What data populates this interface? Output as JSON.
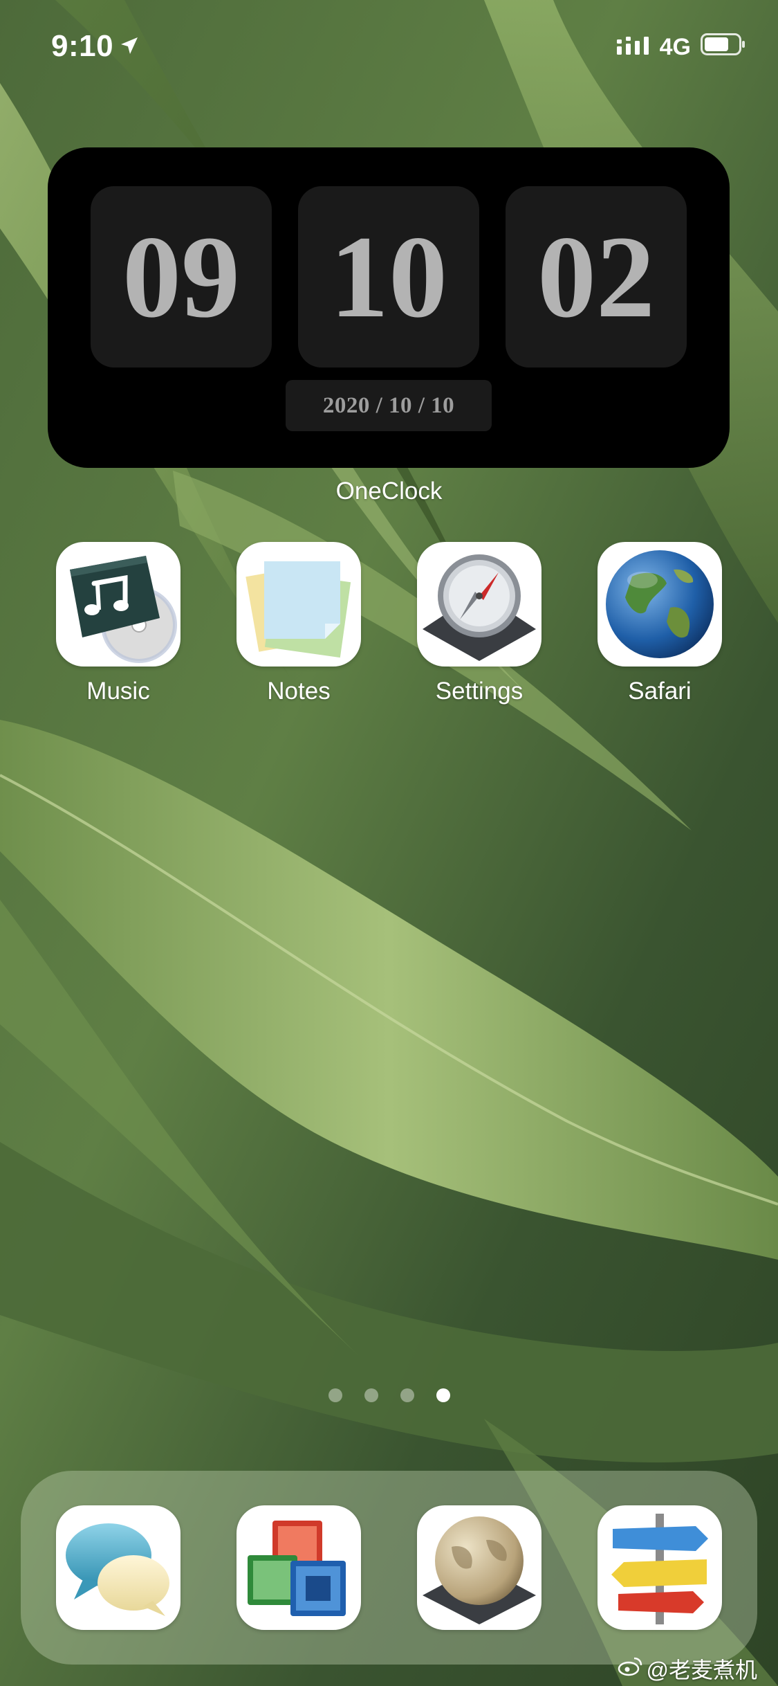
{
  "status_bar": {
    "time": "9:10",
    "network": "4G"
  },
  "widget": {
    "hours": "09",
    "minutes": "10",
    "seconds": "02",
    "date": "2020 / 10 / 10",
    "name": "OneClock"
  },
  "apps": [
    {
      "label": "Music",
      "icon": "music-icon"
    },
    {
      "label": "Notes",
      "icon": "notes-icon"
    },
    {
      "label": "Settings",
      "icon": "compass-icon"
    },
    {
      "label": "Safari",
      "icon": "globe-icon"
    }
  ],
  "page_indicator": {
    "total_pages": 4,
    "current_page": 4
  },
  "dock": [
    {
      "icon": "chat-bubbles-icon"
    },
    {
      "icon": "overlapping-windows-icon"
    },
    {
      "icon": "antique-globe-icon"
    },
    {
      "icon": "signpost-icon"
    }
  ],
  "watermark": {
    "text": "@老麦煮机"
  },
  "colors": {
    "widget_bg": "#000000",
    "tile_bg": "#1a1a1a",
    "digit": "#b3b3b3",
    "wallpaper_leaf": "#7a9a4e"
  }
}
